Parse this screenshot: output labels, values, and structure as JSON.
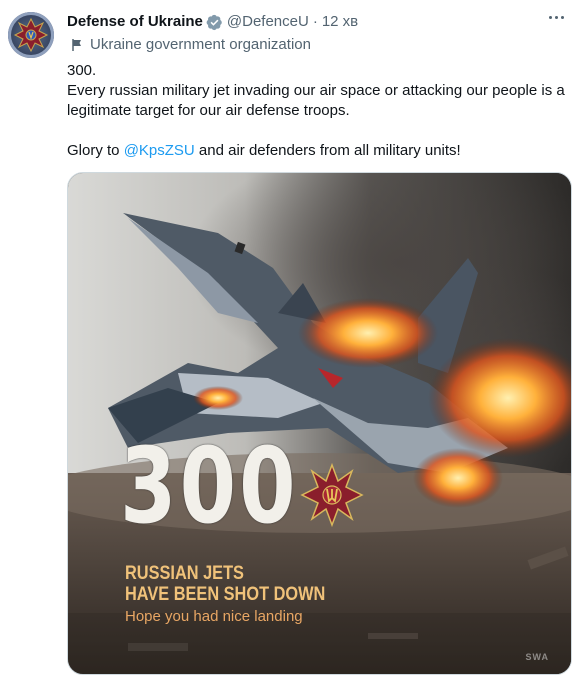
{
  "tweet": {
    "author": {
      "display_name": "Defense of Ukraine",
      "handle": "@DefenceU",
      "verified": true
    },
    "separator": "·",
    "time": "12 хв",
    "affiliation": "Ukraine government organization",
    "text": {
      "line1": "300.",
      "line2": "Every russian military jet invading our air space or attacking our people is a legitimate target for our air defense troops.",
      "line3_prefix": "Glory to ",
      "mention": "@KpsZSU",
      "line3_suffix": " and air defenders from all military units!"
    },
    "media": {
      "number": "300",
      "headline_line1": "RUSSIAN JETS",
      "headline_line2": "HAVE BEEN SHOT DOWN",
      "subline": "Hope you had nice landing",
      "watermark": "SWA"
    }
  },
  "colors": {
    "link": "#1d9bf0",
    "secondary_text": "#536471",
    "verified_badge": "#829aab",
    "headline": "#f0c27a",
    "emblem": "#8a1e2c"
  },
  "icons": {
    "more": "more-options-icon",
    "verified": "verified-badge-icon",
    "affiliation": "flag-icon"
  }
}
